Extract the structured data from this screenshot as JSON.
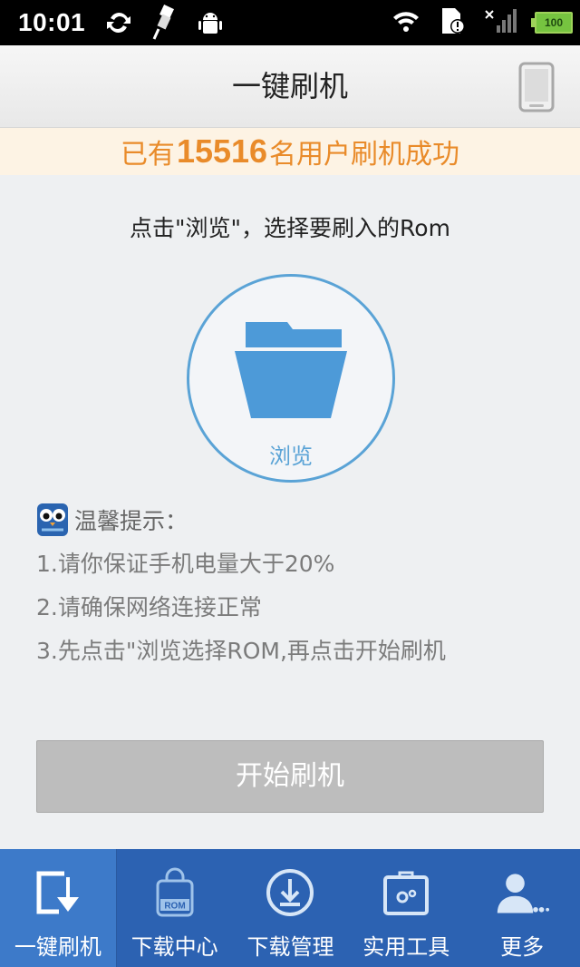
{
  "status_bar": {
    "time": "10:01",
    "battery": "100",
    "icons": [
      "sync-icon",
      "usb-icon",
      "android-debug-icon",
      "wifi-icon",
      "sd-card-alert-icon",
      "signal-icon",
      "battery-icon"
    ]
  },
  "header": {
    "title": "一键刷机",
    "right_icon": "phone-icon"
  },
  "banner": {
    "prefix": "已有",
    "count": "15516",
    "suffix": "名用户刷机成功"
  },
  "main": {
    "instruction": "点击\"浏览\"，选择要刷入的Rom",
    "browse_label": "浏览",
    "tips_title": "温馨提示：",
    "tips": [
      "1.请你保证手机电量大于20%",
      "2.请确保网络连接正常",
      "3.先点击\"浏览选择ROM,再点击开始刷机"
    ],
    "start_button": "开始刷机"
  },
  "bottom_nav": {
    "items": [
      {
        "label": "一键刷机",
        "icon": "flash-icon",
        "active": true
      },
      {
        "label": "下载中心",
        "icon": "rom-bag-icon",
        "active": false
      },
      {
        "label": "下载管理",
        "icon": "download-icon",
        "active": false
      },
      {
        "label": "实用工具",
        "icon": "toolbox-icon",
        "active": false
      },
      {
        "label": "更多",
        "icon": "user-more-icon",
        "active": false
      }
    ],
    "rom_badge": "ROM"
  },
  "colors": {
    "accent_blue": "#5aa3d6",
    "nav_bg": "#2c62b2",
    "nav_active": "#3d7ac9",
    "banner_text": "#e98b2a",
    "banner_bg": "#fdf3e4",
    "button_disabled": "#bdbdbd"
  }
}
